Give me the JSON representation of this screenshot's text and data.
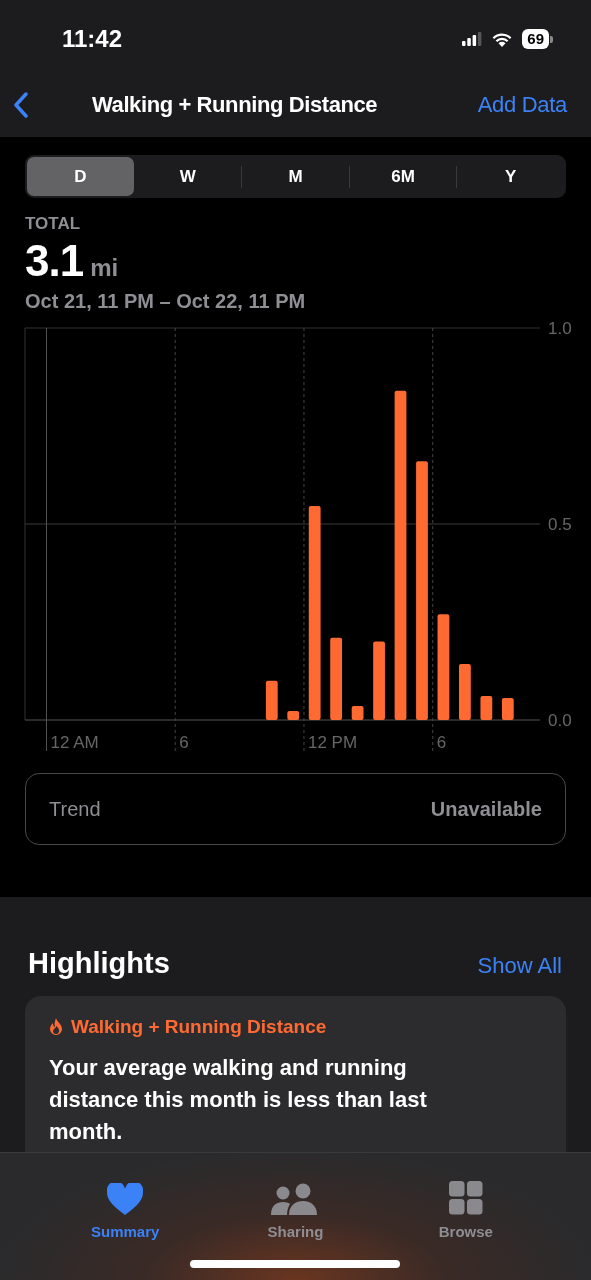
{
  "status_bar": {
    "time": "11:42",
    "battery": "69"
  },
  "nav": {
    "title": "Walking + Running Distance",
    "action": "Add Data"
  },
  "segments": [
    {
      "label": "D",
      "selected": true
    },
    {
      "label": "W",
      "selected": false
    },
    {
      "label": "M",
      "selected": false
    },
    {
      "label": "6M",
      "selected": false
    },
    {
      "label": "Y",
      "selected": false
    }
  ],
  "summary": {
    "label": "TOTAL",
    "value": "3.1",
    "unit": "mi",
    "range": "Oct 21, 11 PM – Oct 22, 11 PM"
  },
  "chart_data": {
    "type": "bar",
    "categories": [
      null,
      null,
      null,
      null,
      null,
      null,
      null,
      null,
      null,
      null,
      null,
      null
    ],
    "series": [
      {
        "color": "#ff6a33",
        "values": [
          0.1,
          0.023,
          0.546,
          0.21,
          0.036,
          0.2,
          0.84,
          0.66,
          0.27,
          0.143,
          0.061,
          0.056
        ]
      }
    ],
    "ylim": [
      0,
      1
    ],
    "ref_lines": [
      {
        "axis": "y",
        "value": 0.5
      }
    ],
    "yticks": [
      {
        "value": 0,
        "label": "0.0"
      },
      {
        "value": 0.5,
        "label": "0.5"
      },
      {
        "value": 1,
        "label": "1.0"
      }
    ]
  },
  "x_axis_labels": [
    "12 AM",
    "6",
    "12 PM",
    "6"
  ],
  "trend": {
    "label": "Trend",
    "value": "Unavailable"
  },
  "highlights": {
    "title": "Highlights",
    "show_all": "Show All",
    "card": {
      "title": "Walking + Running Distance",
      "text": "Your average walking and running distance this month is less than last month."
    }
  },
  "tab_bar": [
    {
      "kind": "heart",
      "label": "Summary",
      "selected": true
    },
    {
      "kind": "people",
      "label": "Sharing",
      "selected": false
    },
    {
      "kind": "grid",
      "label": "Browse",
      "selected": false
    }
  ]
}
